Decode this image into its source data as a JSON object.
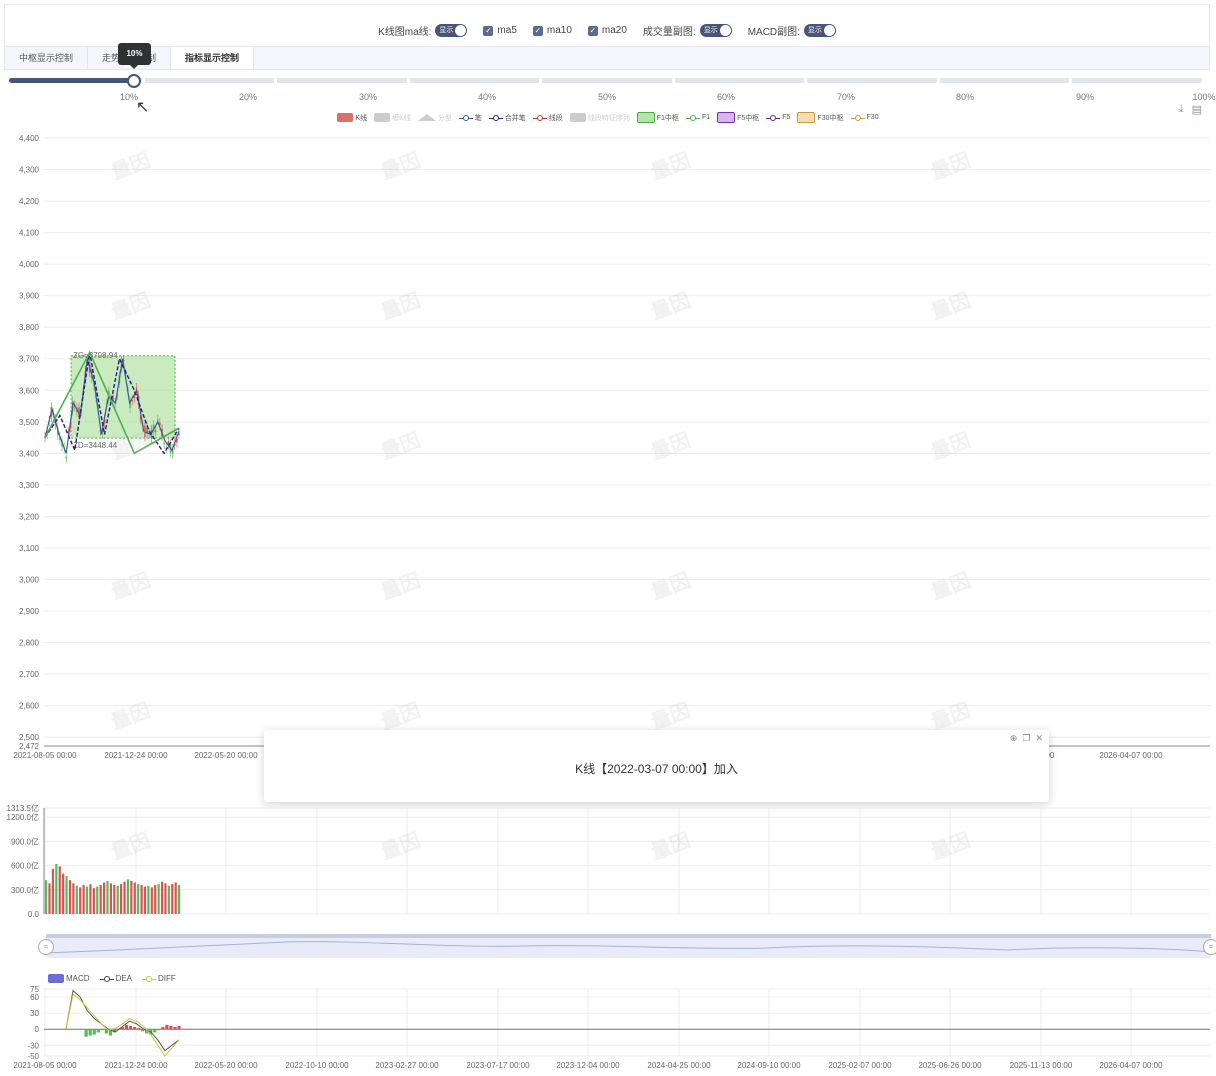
{
  "options": [
    {
      "label": "K线图ma线:",
      "type": "toggle",
      "value": "显示"
    },
    {
      "label": "ma5",
      "type": "checkbox",
      "checked": true
    },
    {
      "label": "ma10",
      "type": "checkbox",
      "checked": true
    },
    {
      "label": "ma20",
      "type": "checkbox",
      "checked": true
    },
    {
      "label": "成交量副图:",
      "type": "toggle",
      "value": "显示"
    },
    {
      "label": "MACD副图:",
      "type": "toggle",
      "value": "显示"
    }
  ],
  "tabs": [
    "中枢显示控制",
    "走势显示控制",
    "指标显示控制"
  ],
  "active_tab": 2,
  "slider": {
    "value": 0.1,
    "tooltip": "10%",
    "marks": [
      "10%",
      "20%",
      "30%",
      "40%",
      "50%",
      "60%",
      "70%",
      "80%",
      "90%",
      "100%"
    ]
  },
  "legend": [
    {
      "label": "K线",
      "kind": "box",
      "color": "#d9706a",
      "on": true
    },
    {
      "label": "缠K线",
      "kind": "box",
      "color": "#cccccc",
      "on": false
    },
    {
      "label": "分型",
      "kind": "tri",
      "color": "#cccccc",
      "on": false
    },
    {
      "label": "笔",
      "kind": "line",
      "color": "#3a5a9a",
      "on": true
    },
    {
      "label": "合并笔",
      "kind": "line",
      "color": "#20207a",
      "on": true
    },
    {
      "label": "线段",
      "kind": "line",
      "color": "#b03a2e",
      "on": true
    },
    {
      "label": "线段特征序列",
      "kind": "box",
      "color": "#cccccc",
      "on": false
    },
    {
      "label": "F1中枢",
      "kind": "box",
      "color": "#b6e3a8",
      "border": "#4caf50",
      "on": true
    },
    {
      "label": "F1",
      "kind": "line",
      "color": "#4caf50",
      "on": true
    },
    {
      "label": "F5中枢",
      "kind": "box",
      "color": "#d6b8f0",
      "border": "#7a2fb0",
      "on": true
    },
    {
      "label": "F5",
      "kind": "line",
      "color": "#5a2aa0",
      "on": true
    },
    {
      "label": "F30中枢",
      "kind": "box",
      "color": "#f3dcb0",
      "border": "#c89a40",
      "on": true
    },
    {
      "label": "F30",
      "kind": "line",
      "color": "#c89a40",
      "on": true
    }
  ],
  "toolbox": {
    "download_icon": "download-icon",
    "data_view_icon": "data-view-icon"
  },
  "main_axis": {
    "y_ticks": [
      "4,400",
      "4,300",
      "4,200",
      "4,100",
      "4,000",
      "3,900",
      "3,800",
      "3,700",
      "3,600",
      "3,500",
      "3,400",
      "3,300",
      "3,200",
      "3,100",
      "3,000",
      "2,900",
      "2,800",
      "2,700",
      "2,600",
      "2,500"
    ],
    "y_min_label": "2,472",
    "x_ticks": [
      "2021-08-05 00:00",
      "2021-12-24 00:00",
      "2022-05-20 00:00",
      "",
      "",
      "",
      "",
      "",
      "",
      "",
      "",
      "6 00:00",
      "2026-04-07 00:00"
    ]
  },
  "zhongshu": {
    "high_label": "ZG=3708.94",
    "low_label": "ZD=3448.44",
    "high": 3708.94,
    "low": 3448.44
  },
  "toast": {
    "message": "K线【2022-03-07 00:00】加入"
  },
  "volume_axis": {
    "y_ticks": [
      "1313.5亿",
      "1200.0亿",
      "900.0亿",
      "600.0亿",
      "300.0亿",
      "0.0"
    ]
  },
  "macd_legend": [
    "MACD",
    "DEA",
    "DIFF"
  ],
  "macd_axis": {
    "y_ticks": [
      "75",
      "60",
      "30",
      "0",
      "-30",
      "-50"
    ],
    "x_ticks": [
      "2021-08-05 00:00",
      "2021-12-24 00:00",
      "2022-05-20 00:00",
      "2022-10-10 00:00",
      "2023-02-27 00:00",
      "2023-07-17 00:00",
      "2023-12-04 00:00",
      "2024-04-25 00:00",
      "2024-09-10 00:00",
      "2025-02-07 00:00",
      "2025-06-26 00:00",
      "2025-11-13 00:00",
      "2026-04-07 00:00"
    ]
  },
  "watermark": "量因",
  "chart_data": [
    {
      "type": "line",
      "title": "",
      "ylim": [
        2472,
        4400
      ],
      "x_range": [
        "2021-08-05",
        "2026-04-07"
      ],
      "series": [
        {
          "values": [
            3450,
            3540,
            3460,
            3400,
            3560,
            3520,
            3700,
            3620,
            3460,
            3580,
            3560,
            3700,
            3560,
            3600,
            3470,
            3460,
            3500,
            3440,
            3410,
            3470
          ]
        },
        {
          "values": [
            3450,
            3520,
            3410,
            3720,
            3460,
            3700,
            3600,
            3470,
            3400,
            3480
          ]
        }
      ]
    },
    {
      "type": "bar",
      "ylim": [
        0,
        1313.5
      ],
      "values": [
        420,
        380,
        560,
        620,
        590,
        500,
        470,
        420,
        380,
        350,
        330,
        360,
        340,
        370,
        320,
        340,
        360,
        390,
        410,
        380,
        360,
        350,
        370,
        400,
        430,
        410,
        390,
        370,
        360,
        340,
        350,
        330,
        360,
        370,
        400,
        380,
        350,
        370,
        390,
        360
      ]
    },
    {
      "type": "line",
      "ylim": [
        -50,
        75
      ],
      "series": [
        {
          "name": "DEA",
          "values": [
            0,
            72,
            60,
            35,
            20,
            10,
            0,
            -5,
            5,
            15,
            10,
            0,
            -5,
            -20,
            -40,
            -30,
            -20
          ]
        },
        {
          "name": "DIFF",
          "values": [
            0,
            65,
            55,
            40,
            25,
            10,
            -2,
            2,
            10,
            20,
            15,
            5,
            -10,
            -30,
            -50,
            -35,
            -20
          ]
        }
      ]
    }
  ]
}
